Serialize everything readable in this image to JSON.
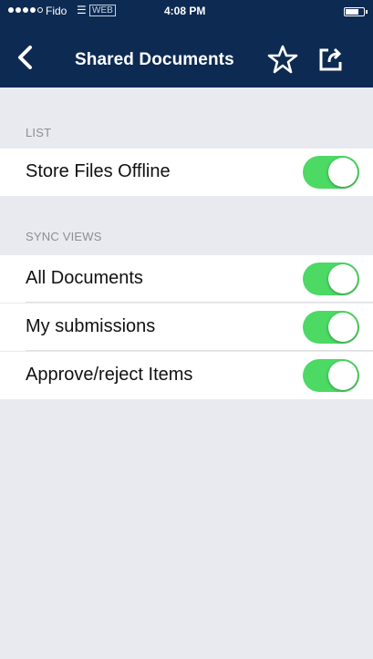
{
  "status_bar": {
    "carrier": "Fido",
    "time": "4:08 PM",
    "network": "WEB"
  },
  "nav": {
    "title": "Shared Documents"
  },
  "sections": [
    {
      "header": "LIST",
      "rows": [
        {
          "label": "Store Files Offline",
          "on": true
        }
      ]
    },
    {
      "header": "SYNC VIEWS",
      "rows": [
        {
          "label": "All Documents",
          "on": true
        },
        {
          "label": "My submissions",
          "on": true
        },
        {
          "label": "Approve/reject Items",
          "on": true
        }
      ]
    }
  ],
  "colors": {
    "nav_background": "#0d2a52",
    "toggle_on": "#4cd964",
    "page_background": "#e9eaef"
  }
}
